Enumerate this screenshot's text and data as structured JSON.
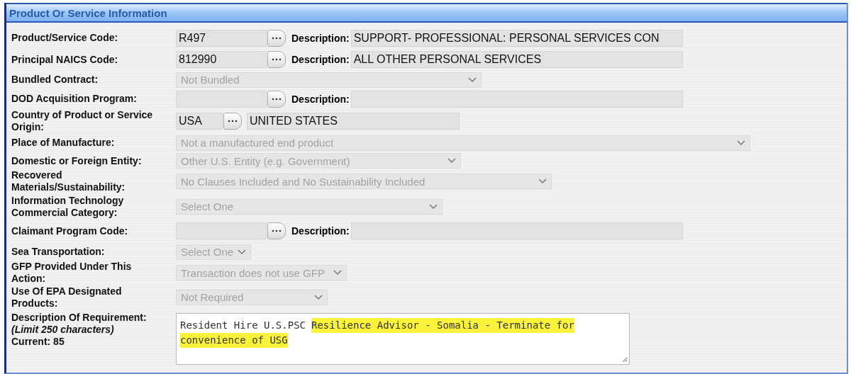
{
  "panel": {
    "title": "Product Or Service Information"
  },
  "rows": [
    {
      "kind": "lookup",
      "label": "Product/Service Code:",
      "code": "R497",
      "description_label": "Description:",
      "description": "SUPPORT- PROFESSIONAL: PERSONAL SERVICES CON"
    },
    {
      "kind": "lookup",
      "label": "Principal NAICS Code:",
      "code": "812990",
      "description_label": "Description:",
      "description": "ALL OTHER PERSONAL SERVICES"
    },
    {
      "kind": "select",
      "label": "Bundled Contract:",
      "value": "Not Bundled",
      "disabled": true
    },
    {
      "kind": "lookup",
      "label": "DOD Acquisition Program:",
      "description_label": "Description:"
    },
    {
      "kind": "lookup_inline",
      "label": "Country of Product or Service Origin:",
      "code": "USA",
      "description": "UNITED STATES"
    },
    {
      "kind": "select",
      "label": "Place of Manufacture:",
      "value": "Not a manufactured end product",
      "disabled": true
    },
    {
      "kind": "select",
      "label": "Domestic or Foreign Entity:",
      "value": "Other U.S. Entity (e.g. Government)",
      "disabled": true
    },
    {
      "kind": "select",
      "label": "Recovered Materials/Sustainability:",
      "value": "No Clauses Included and No Sustainability Included",
      "disabled": true
    },
    {
      "kind": "select",
      "label": "Information Technology Commercial Category:",
      "value": "Select One",
      "disabled": true
    },
    {
      "kind": "lookup",
      "label": "Claimant Program Code:",
      "description_label": "Description:"
    },
    {
      "kind": "select",
      "label": "Sea Transportation:",
      "value": "Select One",
      "disabled": true
    },
    {
      "kind": "select",
      "label": "GFP Provided Under This Action:",
      "value": "Transaction does not use GFP",
      "disabled": true
    },
    {
      "kind": "select",
      "label": "Use Of EPA Designated Products:",
      "value": "Not Required",
      "disabled": true
    },
    {
      "kind": "textarea",
      "label": "Description Of Requirement:",
      "limit_note": "(Limit 250 characters)",
      "count": "Current: 85",
      "lines": [
        {
          "parts": [
            {
              "text": "Resident Hire U.S.PSC",
              "highlighted": false
            },
            {
              "text": "Resilience Advisor - Somalia - Terminate for",
              "highlighted": true
            }
          ]
        },
        {
          "parts": [
            {
              "text": "convenience of USG",
              "highlighted": true
            }
          ]
        }
      ]
    }
  ]
}
